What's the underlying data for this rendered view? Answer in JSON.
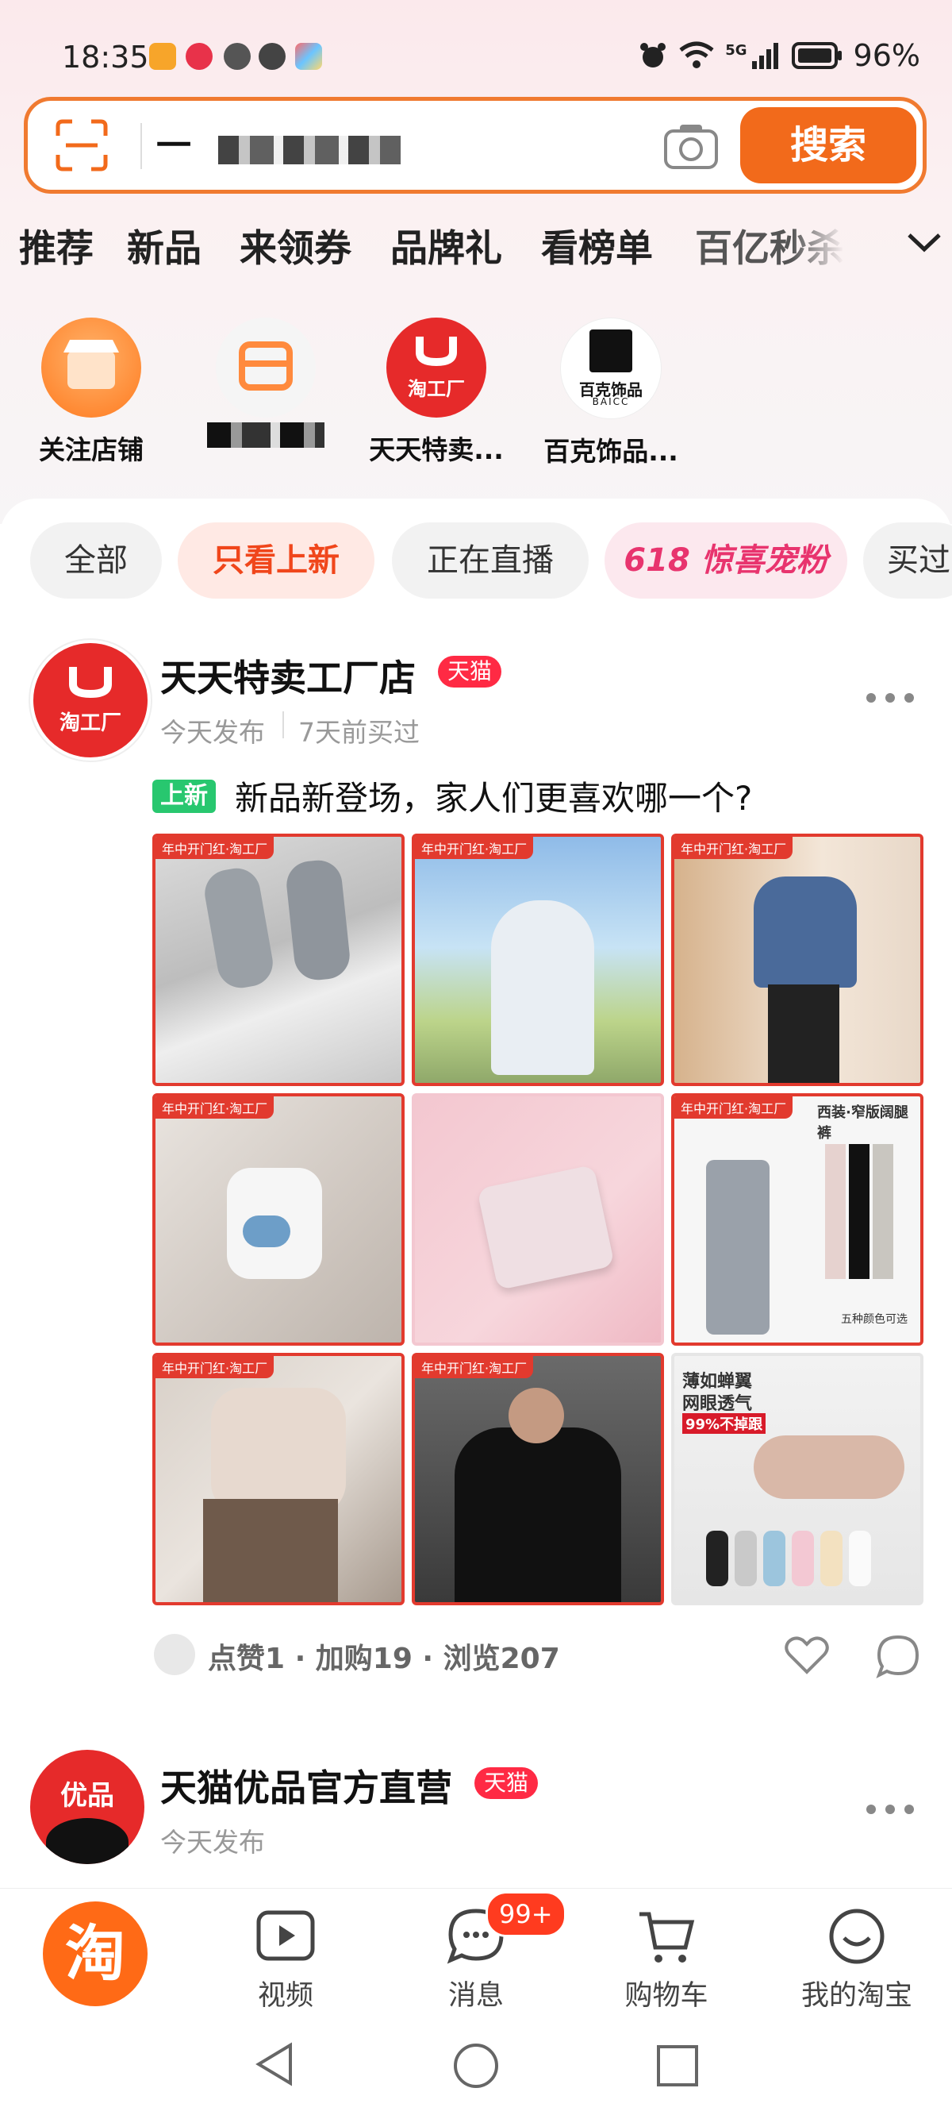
{
  "status_bar": {
    "time": "18:35",
    "battery": "96%",
    "network": "5G",
    "icons": [
      "vip-app-icon",
      "video-app-icon",
      "gesture-icon",
      "chat-bubble-icon",
      "app-grid-icon",
      "alarm-icon",
      "wifi-icon",
      "signal-icon",
      "battery-icon"
    ]
  },
  "search": {
    "query_prefix": "一",
    "button_label": "搜索"
  },
  "category_tabs": [
    "推荐",
    "新品",
    "来领券",
    "品牌礼",
    "看榜单",
    "百亿秒杀"
  ],
  "stores": [
    {
      "name": "关注店铺",
      "avatar_label": ""
    },
    {
      "name": "",
      "avatar_label": ""
    },
    {
      "name": "天天特卖...",
      "avatar_label": "淘工厂"
    },
    {
      "name": "百克饰品...",
      "avatar_label": "百克饰品",
      "avatar_sub": "BAICC"
    }
  ],
  "filters": [
    "全部",
    "只看上新",
    "正在直播",
    "618 惊喜宠粉",
    "买过"
  ],
  "posts": [
    {
      "store_name": "天天特卖工厂店",
      "badge": "天猫",
      "avatar_label": "淘工厂",
      "published": "今天发布",
      "bought": "7天前买过",
      "new_tag": "上新",
      "text": "新品新登场，家人们更喜欢哪一个?",
      "stats": "点赞1 · 加购19 · 浏览207",
      "tiles": [
        {
          "tag": "年中开门红·淘工厂",
          "desc": "gray socks"
        },
        {
          "tag": "年中开门红·淘工厂",
          "desc": "sun sleeves"
        },
        {
          "tag": "年中开门红·淘工厂",
          "desc": "denim jacket"
        },
        {
          "tag": "年中开门红·淘工厂",
          "desc": "white outfit"
        },
        {
          "tag": "",
          "desc": "pink wallet"
        },
        {
          "tag": "年中开门红·淘工厂",
          "desc": "wide pants",
          "text": "西装·窄版阔腿裤",
          "text2": "五种颜色可选"
        },
        {
          "tag": "年中开门红·淘工厂",
          "desc": "linen shirt"
        },
        {
          "tag": "年中开门红·淘工厂",
          "desc": "black polo"
        },
        {
          "tag": "",
          "desc": "boat socks",
          "text": "薄如蝉翼",
          "text2": "网眼透气",
          "text3": "99%不掉跟"
        }
      ]
    },
    {
      "store_name": "天猫优品官方直营",
      "badge": "天猫",
      "avatar_label": "优品",
      "published": "今天发布"
    }
  ],
  "bottom_nav": {
    "home_glyph": "淘",
    "items": [
      "视频",
      "消息",
      "购物车",
      "我的淘宝"
    ],
    "message_badge": "99+"
  },
  "colors": {
    "accent": "#f26a1b",
    "tmall_red": "#ff2a44",
    "new_green": "#28c76f",
    "tile_border": "#e23a2e"
  }
}
